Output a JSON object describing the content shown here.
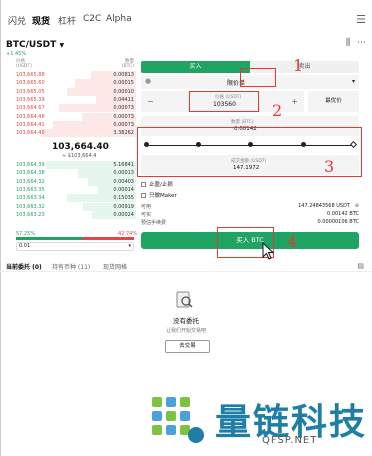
{
  "nav": {
    "tabs": [
      "闪兑",
      "现货",
      "杠杆",
      "C2C",
      "Alpha"
    ],
    "active": 1
  },
  "pair": {
    "title": "BTC/USDT",
    "change": "+1.45%"
  },
  "orderbook": {
    "head_price": "价格",
    "head_price_unit": "(USDT)",
    "head_amount": "数量",
    "head_amount_unit": "(BTC)",
    "asks": [
      {
        "price": "103,665.88",
        "amount": "0.00813"
      },
      {
        "price": "103,665.60",
        "amount": "0.00015"
      },
      {
        "price": "103,665.05",
        "amount": "0.00010"
      },
      {
        "price": "103,665.39",
        "amount": "0.04411"
      },
      {
        "price": "103,664.67",
        "amount": "0.00073"
      },
      {
        "price": "103,664.48",
        "amount": "0.00073"
      },
      {
        "price": "103,664.41",
        "amount": "0.00073"
      },
      {
        "price": "103,664.40",
        "amount": "3.38262"
      }
    ],
    "mid_price": "103,664.40",
    "mid_sub": "≈ $103,664.4",
    "bids": [
      {
        "price": "103,664.39",
        "amount": "5.16841"
      },
      {
        "price": "103,664.38",
        "amount": "0.00013"
      },
      {
        "price": "103,664.32",
        "amount": "0.00403"
      },
      {
        "price": "103,663.35",
        "amount": "0.00014"
      },
      {
        "price": "103,663.34",
        "amount": "0.15035"
      },
      {
        "price": "103,663.32",
        "amount": "0.00919"
      },
      {
        "price": "103,663.23",
        "amount": "0.00024"
      }
    ],
    "buy_ratio": "57.25%",
    "sell_ratio": "42.74%",
    "precision": "0.01"
  },
  "trade": {
    "buy_tab": "买入",
    "sell_tab": "卖出",
    "order_type": "限价单",
    "price_label": "价格 (USDT)",
    "price_value": "103560",
    "best_price": "最优价",
    "qty_label": "数量 (BTC)",
    "qty_value": "0.00142",
    "total_label": "成交金额 (USDT)",
    "total_value": "147.1972",
    "chk1": "止盈/止损",
    "chk2": "只做Maker",
    "available_label": "可用",
    "available_value": "147.24843568 USDT",
    "buyable_label": "可买",
    "buyable_value": "0.00142 BTC",
    "fee_label": "预估手续费",
    "fee_value": "0.00000106 BTC",
    "buy_button": "买入 BTC"
  },
  "annotations": [
    "1",
    "2",
    "3",
    "4"
  ],
  "bottom": {
    "tabs": [
      "当前委托 (0)",
      "持有币种 (11)",
      "现货网格"
    ],
    "empty_title": "没有委托",
    "empty_sub": "让我们开始交易吧",
    "go_trade": "去交易"
  },
  "watermark": {
    "text": "量链科技",
    "url": "QFSP.NET"
  },
  "colors": {
    "green": "#1fa463",
    "red": "#e04747",
    "annotation": "#e53935",
    "brand": "#1f7ea6"
  }
}
